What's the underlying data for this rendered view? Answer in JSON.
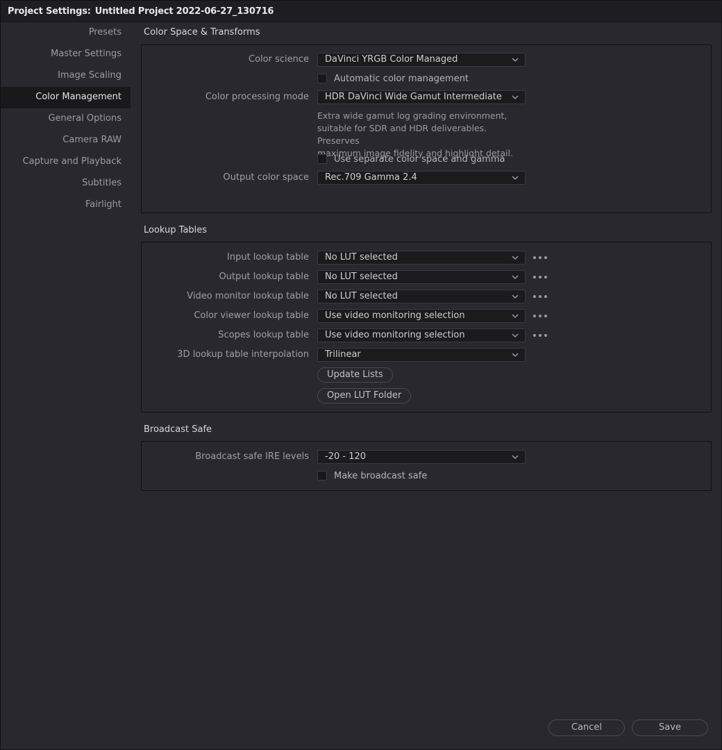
{
  "window": {
    "title_prefix": "Project Settings:",
    "project_name": "Untitled Project 2022-06-27_130716"
  },
  "sidebar": {
    "items": [
      {
        "label": "Presets"
      },
      {
        "label": "Master Settings"
      },
      {
        "label": "Image Scaling"
      },
      {
        "label": "Color Management",
        "active": true
      },
      {
        "label": "General Options"
      },
      {
        "label": "Camera RAW"
      },
      {
        "label": "Capture and Playback"
      },
      {
        "label": "Subtitles"
      },
      {
        "label": "Fairlight"
      }
    ]
  },
  "color_space": {
    "title": "Color Space & Transforms",
    "color_science_label": "Color science",
    "color_science_value": "DaVinci YRGB Color Managed",
    "auto_color_mgmt_label": "Automatic color management",
    "processing_mode_label": "Color processing mode",
    "processing_mode_value": "HDR DaVinci Wide Gamut Intermediate",
    "processing_desc": [
      "Extra wide gamut log grading environment,",
      "suitable for SDR and HDR deliverables. Preserves",
      "maximum image fidelity and highlight detail."
    ],
    "separate_label": "Use separate color space and gamma",
    "output_label": "Output color space",
    "output_value": "Rec.709 Gamma 2.4"
  },
  "lookup_tables": {
    "title": "Lookup Tables",
    "rows": [
      {
        "label": "Input lookup table",
        "value": "No LUT selected"
      },
      {
        "label": "Output lookup table",
        "value": "No LUT selected"
      },
      {
        "label": "Video monitor lookup table",
        "value": "No LUT selected"
      },
      {
        "label": "Color viewer lookup table",
        "value": "Use video monitoring selection"
      },
      {
        "label": "Scopes lookup table",
        "value": "Use video monitoring selection"
      }
    ],
    "interp_label": "3D lookup table interpolation",
    "interp_value": "Trilinear",
    "update_button": "Update Lists",
    "open_folder_button": "Open LUT Folder"
  },
  "broadcast_safe": {
    "title": "Broadcast Safe",
    "ire_label": "Broadcast safe IRE levels",
    "ire_value": "-20 - 120",
    "make_safe_label": "Make broadcast safe"
  },
  "footer": {
    "cancel": "Cancel",
    "save": "Save"
  },
  "colors": {
    "background": "#28282e",
    "titlebar": "#1e1e22",
    "active_sidebar": "#19191c",
    "dropdown": "#1b1b1e"
  }
}
